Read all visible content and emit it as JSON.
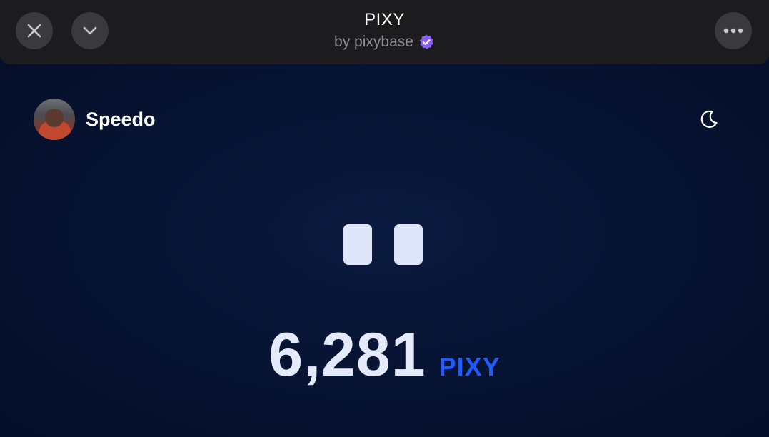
{
  "header": {
    "title": "PIXY",
    "subtitle": "by pixybase",
    "verified_color": "#8b5cf6",
    "close_icon": "close-icon",
    "collapse_icon": "chevron-down-icon",
    "more_icon": "more-horizontal-icon"
  },
  "user": {
    "name": "Speedo",
    "avatar": "avatar"
  },
  "theme_toggle": {
    "icon": "moon-icon"
  },
  "mascot": {
    "icon": "eyes-icon"
  },
  "balance": {
    "amount": "6,281",
    "unit": "PIXY",
    "unit_color": "#1f5bff"
  },
  "colors": {
    "background": "#06112e",
    "header_bg": "#1c1c1e",
    "button_bg": "#3a3a3c"
  }
}
